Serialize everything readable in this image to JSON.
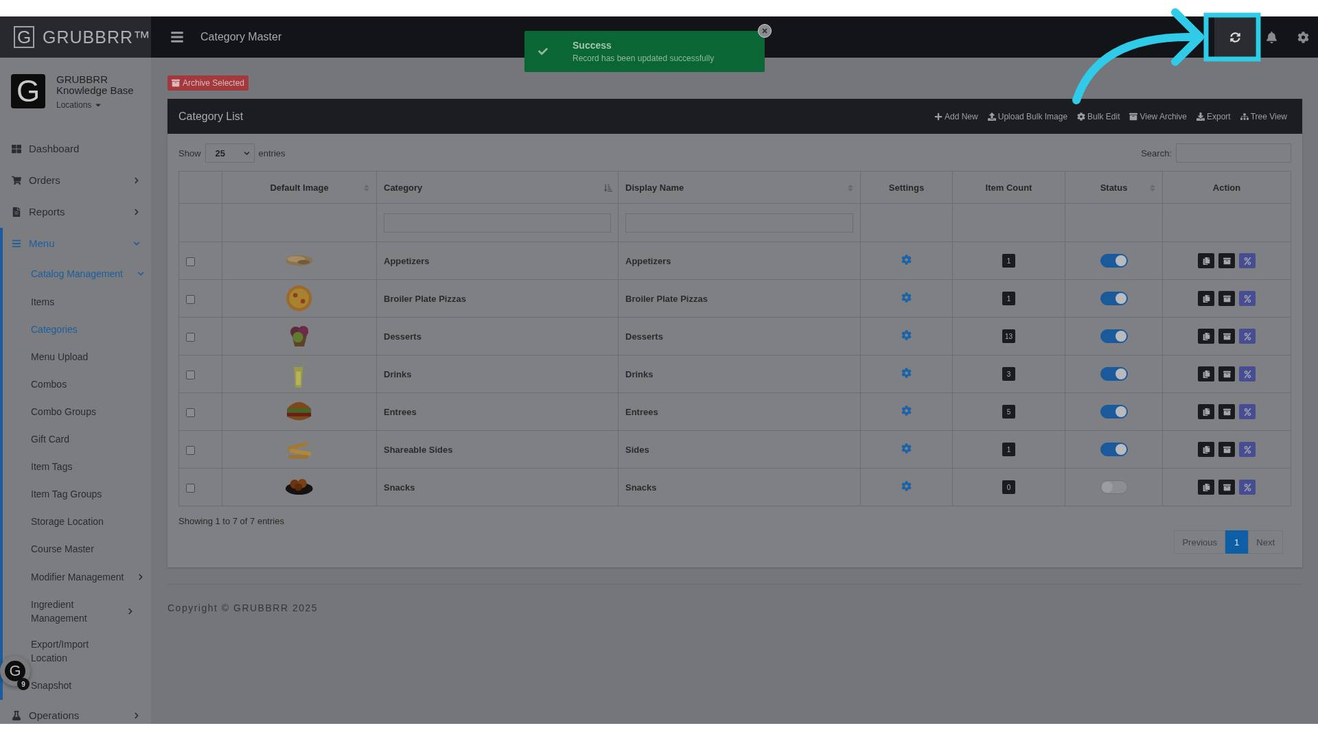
{
  "brand": {
    "logo_letter": "G",
    "name": "GRUBBRR™"
  },
  "header": {
    "title": "Category Master"
  },
  "toast": {
    "title": "Success",
    "message": "Record has been updated successfully"
  },
  "profile": {
    "logo_letter": "G",
    "name": "GRUBBRR Knowledge Base",
    "location_menu": "Locations"
  },
  "sidebar": {
    "items": [
      {
        "label": "Dashboard",
        "kind": "link",
        "selected": false
      },
      {
        "label": "Orders",
        "kind": "group",
        "expanded": false,
        "selected": false
      },
      {
        "label": "Reports",
        "kind": "group",
        "expanded": false,
        "selected": false
      },
      {
        "label": "Menu",
        "kind": "group",
        "expanded": true,
        "selected": true,
        "children": [
          {
            "label": "Catalog Management",
            "kind": "group",
            "expanded": true,
            "selected": true,
            "children": [
              {
                "label": "Items",
                "kind": "link",
                "selected": false
              },
              {
                "label": "Categories",
                "kind": "link",
                "selected": true
              },
              {
                "label": "Menu Upload",
                "kind": "link",
                "selected": false
              },
              {
                "label": "Combos",
                "kind": "link",
                "selected": false
              },
              {
                "label": "Combo Groups",
                "kind": "link",
                "selected": false
              },
              {
                "label": "Gift Card",
                "kind": "link",
                "selected": false
              },
              {
                "label": "Item Tags",
                "kind": "link",
                "selected": false
              },
              {
                "label": "Item Tag Groups",
                "kind": "link",
                "selected": false
              },
              {
                "label": "Storage Location",
                "kind": "link",
                "selected": false
              },
              {
                "label": "Course Master",
                "kind": "link",
                "selected": false
              }
            ]
          },
          {
            "label": "Modifier Management",
            "kind": "group",
            "expanded": false,
            "selected": false
          },
          {
            "label": "Ingredient Management",
            "kind": "group",
            "expanded": false,
            "selected": false
          },
          {
            "label": "Export/Import Location",
            "kind": "link",
            "selected": false
          },
          {
            "label": "Snapshot",
            "kind": "link",
            "selected": false
          }
        ]
      },
      {
        "label": "Operations",
        "kind": "group",
        "expanded": false,
        "selected": false
      }
    ]
  },
  "archive_button": "Archive Selected",
  "card": {
    "title": "Category List",
    "actions": [
      "Add New",
      "Upload Bulk Image",
      "Bulk Edit",
      "View Archive",
      "Export",
      "Tree View"
    ]
  },
  "length_menu": {
    "before": "Show",
    "value": "25",
    "after": "entries"
  },
  "search": {
    "label": "Search:"
  },
  "table": {
    "columns": [
      {
        "label": "Default Image",
        "sortable": true,
        "sorted": false
      },
      {
        "label": "Category",
        "sortable": true,
        "sorted": true
      },
      {
        "label": "Display Name",
        "sortable": true,
        "sorted": false
      },
      {
        "label": "Settings",
        "sortable": false,
        "sorted": false
      },
      {
        "label": "Item Count",
        "sortable": false,
        "sorted": false
      },
      {
        "label": "Status",
        "sortable": true,
        "sorted": false
      },
      {
        "label": "Action",
        "sortable": false,
        "sorted": false
      }
    ],
    "rows": [
      {
        "checked": false,
        "category": "Appetizers",
        "display_name": "Appetizers",
        "item_count": "1",
        "on": true
      },
      {
        "checked": false,
        "category": "Broiler Plate Pizzas",
        "display_name": "Broiler Plate Pizzas",
        "item_count": "1",
        "on": true
      },
      {
        "checked": false,
        "category": "Desserts",
        "display_name": "Desserts",
        "item_count": "13",
        "on": true
      },
      {
        "checked": false,
        "category": "Drinks",
        "display_name": "Drinks",
        "item_count": "3",
        "on": true
      },
      {
        "checked": false,
        "category": "Entrees",
        "display_name": "Entrees",
        "item_count": "5",
        "on": true
      },
      {
        "checked": false,
        "category": "Shareable Sides",
        "display_name": "Sides",
        "item_count": "1",
        "on": true
      },
      {
        "checked": false,
        "category": "Snacks",
        "display_name": "Snacks",
        "item_count": "0",
        "on": false
      }
    ]
  },
  "info": "Showing 1 to 7 of 7 entries",
  "pagination": [
    {
      "label": "Previous",
      "kind": "nav",
      "disabled": true,
      "selected": false
    },
    {
      "label": "1",
      "kind": "page",
      "disabled": false,
      "selected": true
    },
    {
      "label": "Next",
      "kind": "nav",
      "disabled": true,
      "selected": false
    }
  ],
  "footer": "Copyright © GRUBBRR 2025",
  "chat": {
    "logo_letter": "G",
    "badge": "9"
  }
}
